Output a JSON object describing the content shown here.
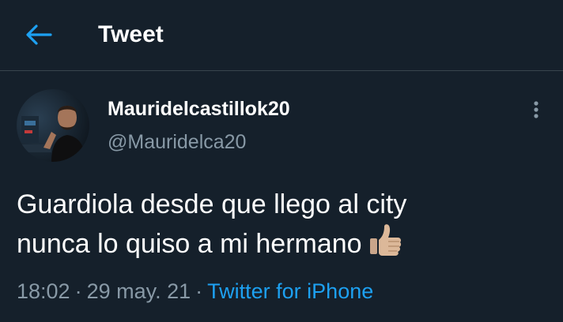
{
  "header": {
    "title": "Tweet"
  },
  "tweet": {
    "author_name": "Mauridelcastillok20",
    "author_handle": "@Mauridelca20",
    "text_line1": "Guardiola desde que llego al city",
    "text_line2": "nunca lo quiso a mi hermano",
    "emoji": "thumbs-up-medium-light-skin-tone",
    "time": "18:02",
    "date": "29 may. 21",
    "separator": "·",
    "source": "Twitter for iPhone"
  },
  "colors": {
    "background": "#15202b",
    "accent": "#1da1f2",
    "secondary_text": "#8899a6",
    "divider": "#38444d"
  },
  "icons": {
    "back": "arrow-left-icon",
    "more": "more-vertical-icon"
  }
}
